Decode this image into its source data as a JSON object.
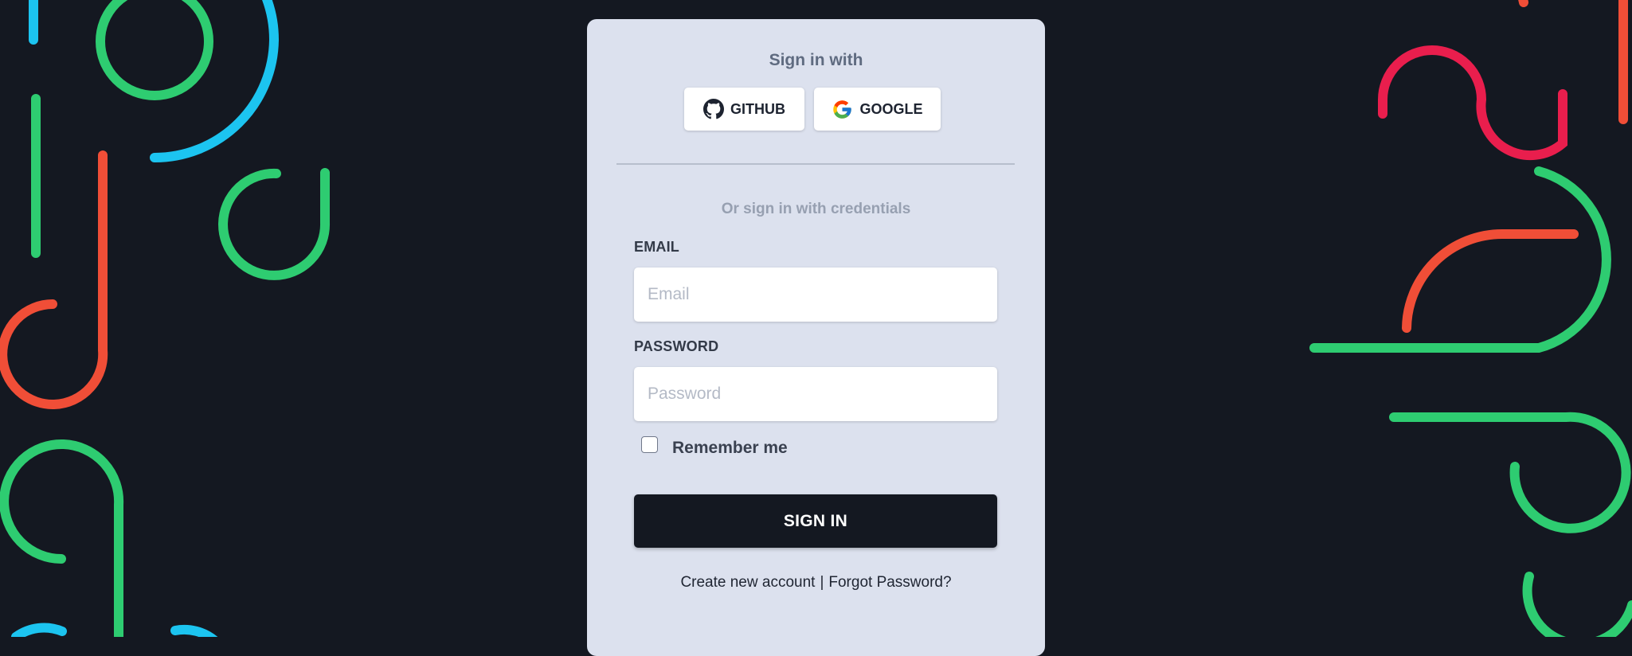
{
  "card": {
    "heading": "Sign in with",
    "github_label": "GITHUB",
    "google_label": "GOOGLE",
    "or_text": "Or sign in with credentials",
    "email_label": "EMAIL",
    "email_placeholder": "Email",
    "email_value": "",
    "password_label": "PASSWORD",
    "password_placeholder": "Password",
    "password_value": "",
    "remember_label": "Remember me",
    "remember_checked": false,
    "submit_label": "SIGN IN",
    "create_account_label": "Create new account",
    "separator": "|",
    "forgot_password_label": "Forgot Password?"
  },
  "icons": {
    "github": "github-icon",
    "google": "google-icon"
  },
  "colors": {
    "background": "#141821",
    "card": "#dce1ee",
    "submit_button": "#141821",
    "decor_green": "#2ecc71",
    "decor_red": "#f04e37",
    "decor_pink": "#e91e4d",
    "decor_blue": "#1cc4f0"
  }
}
